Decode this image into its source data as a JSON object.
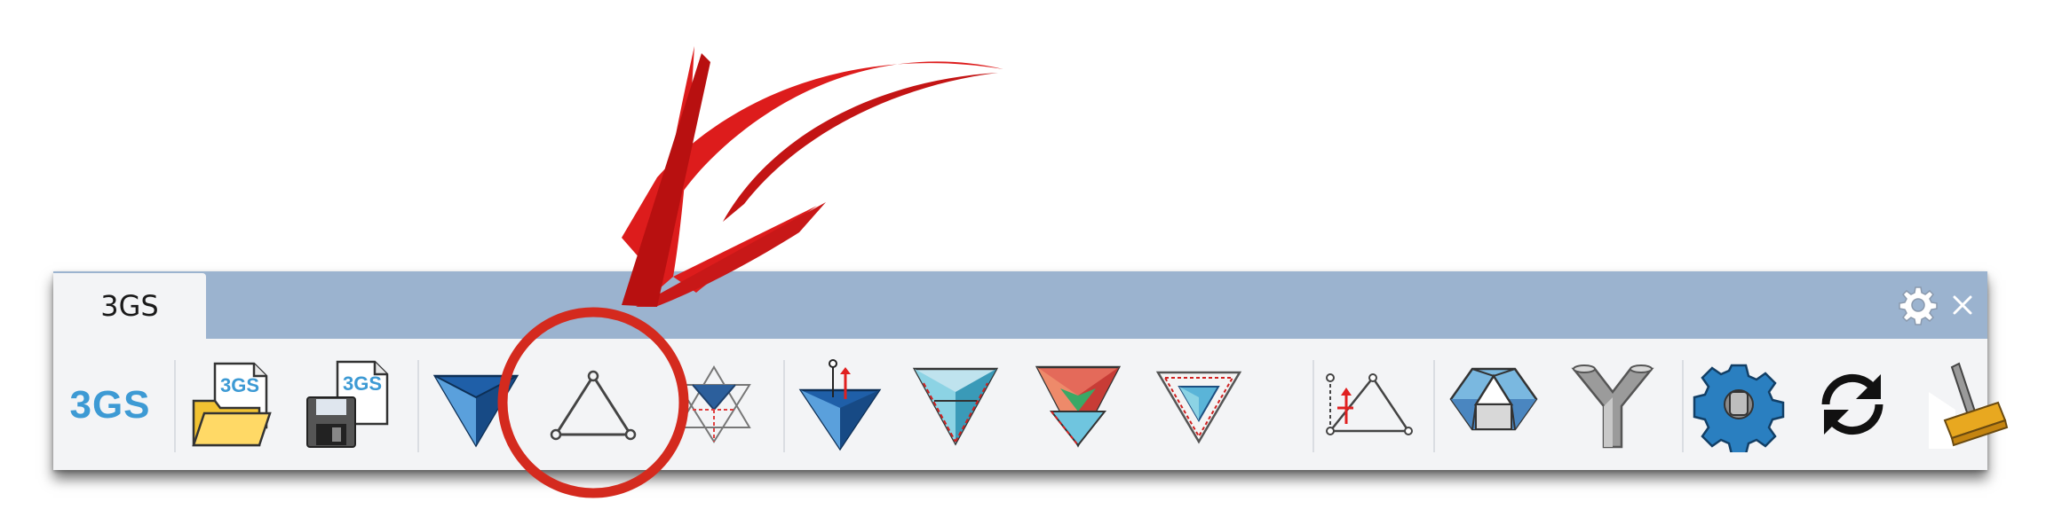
{
  "tab": {
    "label": "3GS"
  },
  "toolbar": {
    "brand_label": "3GS",
    "open_icon_text": "3GS",
    "save_icon_text": "3GS",
    "tools": [
      "open-file",
      "save-file",
      "form-diagram",
      "triangle-form",
      "force-star",
      "support-form",
      "force-triangle",
      "force-colored",
      "force-small",
      "load-form",
      "polyhedron",
      "node-y",
      "settings-gear",
      "refresh",
      "clear"
    ]
  },
  "colors": {
    "tab_bar": "#9bb3cf",
    "panel": "#f3f4f6",
    "brand": "#3d9ad4",
    "annotation_red": "#d81c1c"
  }
}
